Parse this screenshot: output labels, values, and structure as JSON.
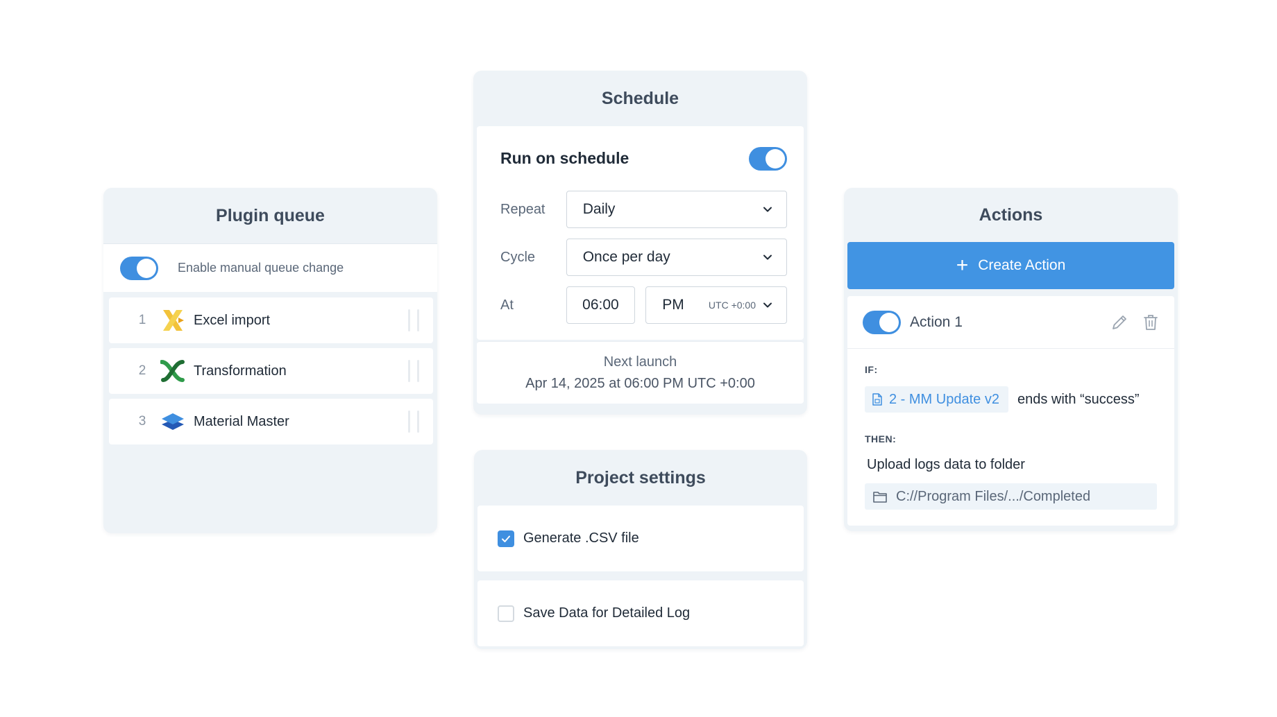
{
  "plugin_queue": {
    "title": "Plugin queue",
    "manual_change_label": "Enable manual queue change",
    "manual_change_enabled": true,
    "items": [
      {
        "num": "1",
        "name": "Excel import",
        "icon": "excel-x-icon"
      },
      {
        "num": "2",
        "name": "Transformation",
        "icon": "transformation-icon"
      },
      {
        "num": "3",
        "name": "Material Master",
        "icon": "layers-icon"
      }
    ]
  },
  "schedule": {
    "title": "Schedule",
    "run_label": "Run on schedule",
    "run_enabled": true,
    "repeat_label": "Repeat",
    "repeat_value": "Daily",
    "cycle_label": "Cycle",
    "cycle_value": "Once per day",
    "at_label": "At",
    "time_value": "06:00",
    "ampm_value": "PM",
    "timezone": "UTC +0:00",
    "next_launch_label": "Next launch",
    "next_launch_value": "Apr 14, 2025 at 06:00 PM UTC +0:00"
  },
  "project_settings": {
    "title": "Project settings",
    "options": [
      {
        "label": "Generate .CSV file",
        "checked": true
      },
      {
        "label": "Save Data for Detailed Log",
        "checked": false
      }
    ]
  },
  "actions": {
    "title": "Actions",
    "create_label": "Create Action",
    "items": [
      {
        "name": "Action 1",
        "enabled": true,
        "if_label": "IF:",
        "if_source": "2 - MM Update v2",
        "if_condition": "ends with “success”",
        "then_label": "THEN:",
        "then_text": "Upload logs data to folder",
        "then_path": "C://Program Files/.../Completed"
      }
    ]
  },
  "colors": {
    "accent": "#3f8fe0",
    "panel_bg": "#eef3f7"
  }
}
